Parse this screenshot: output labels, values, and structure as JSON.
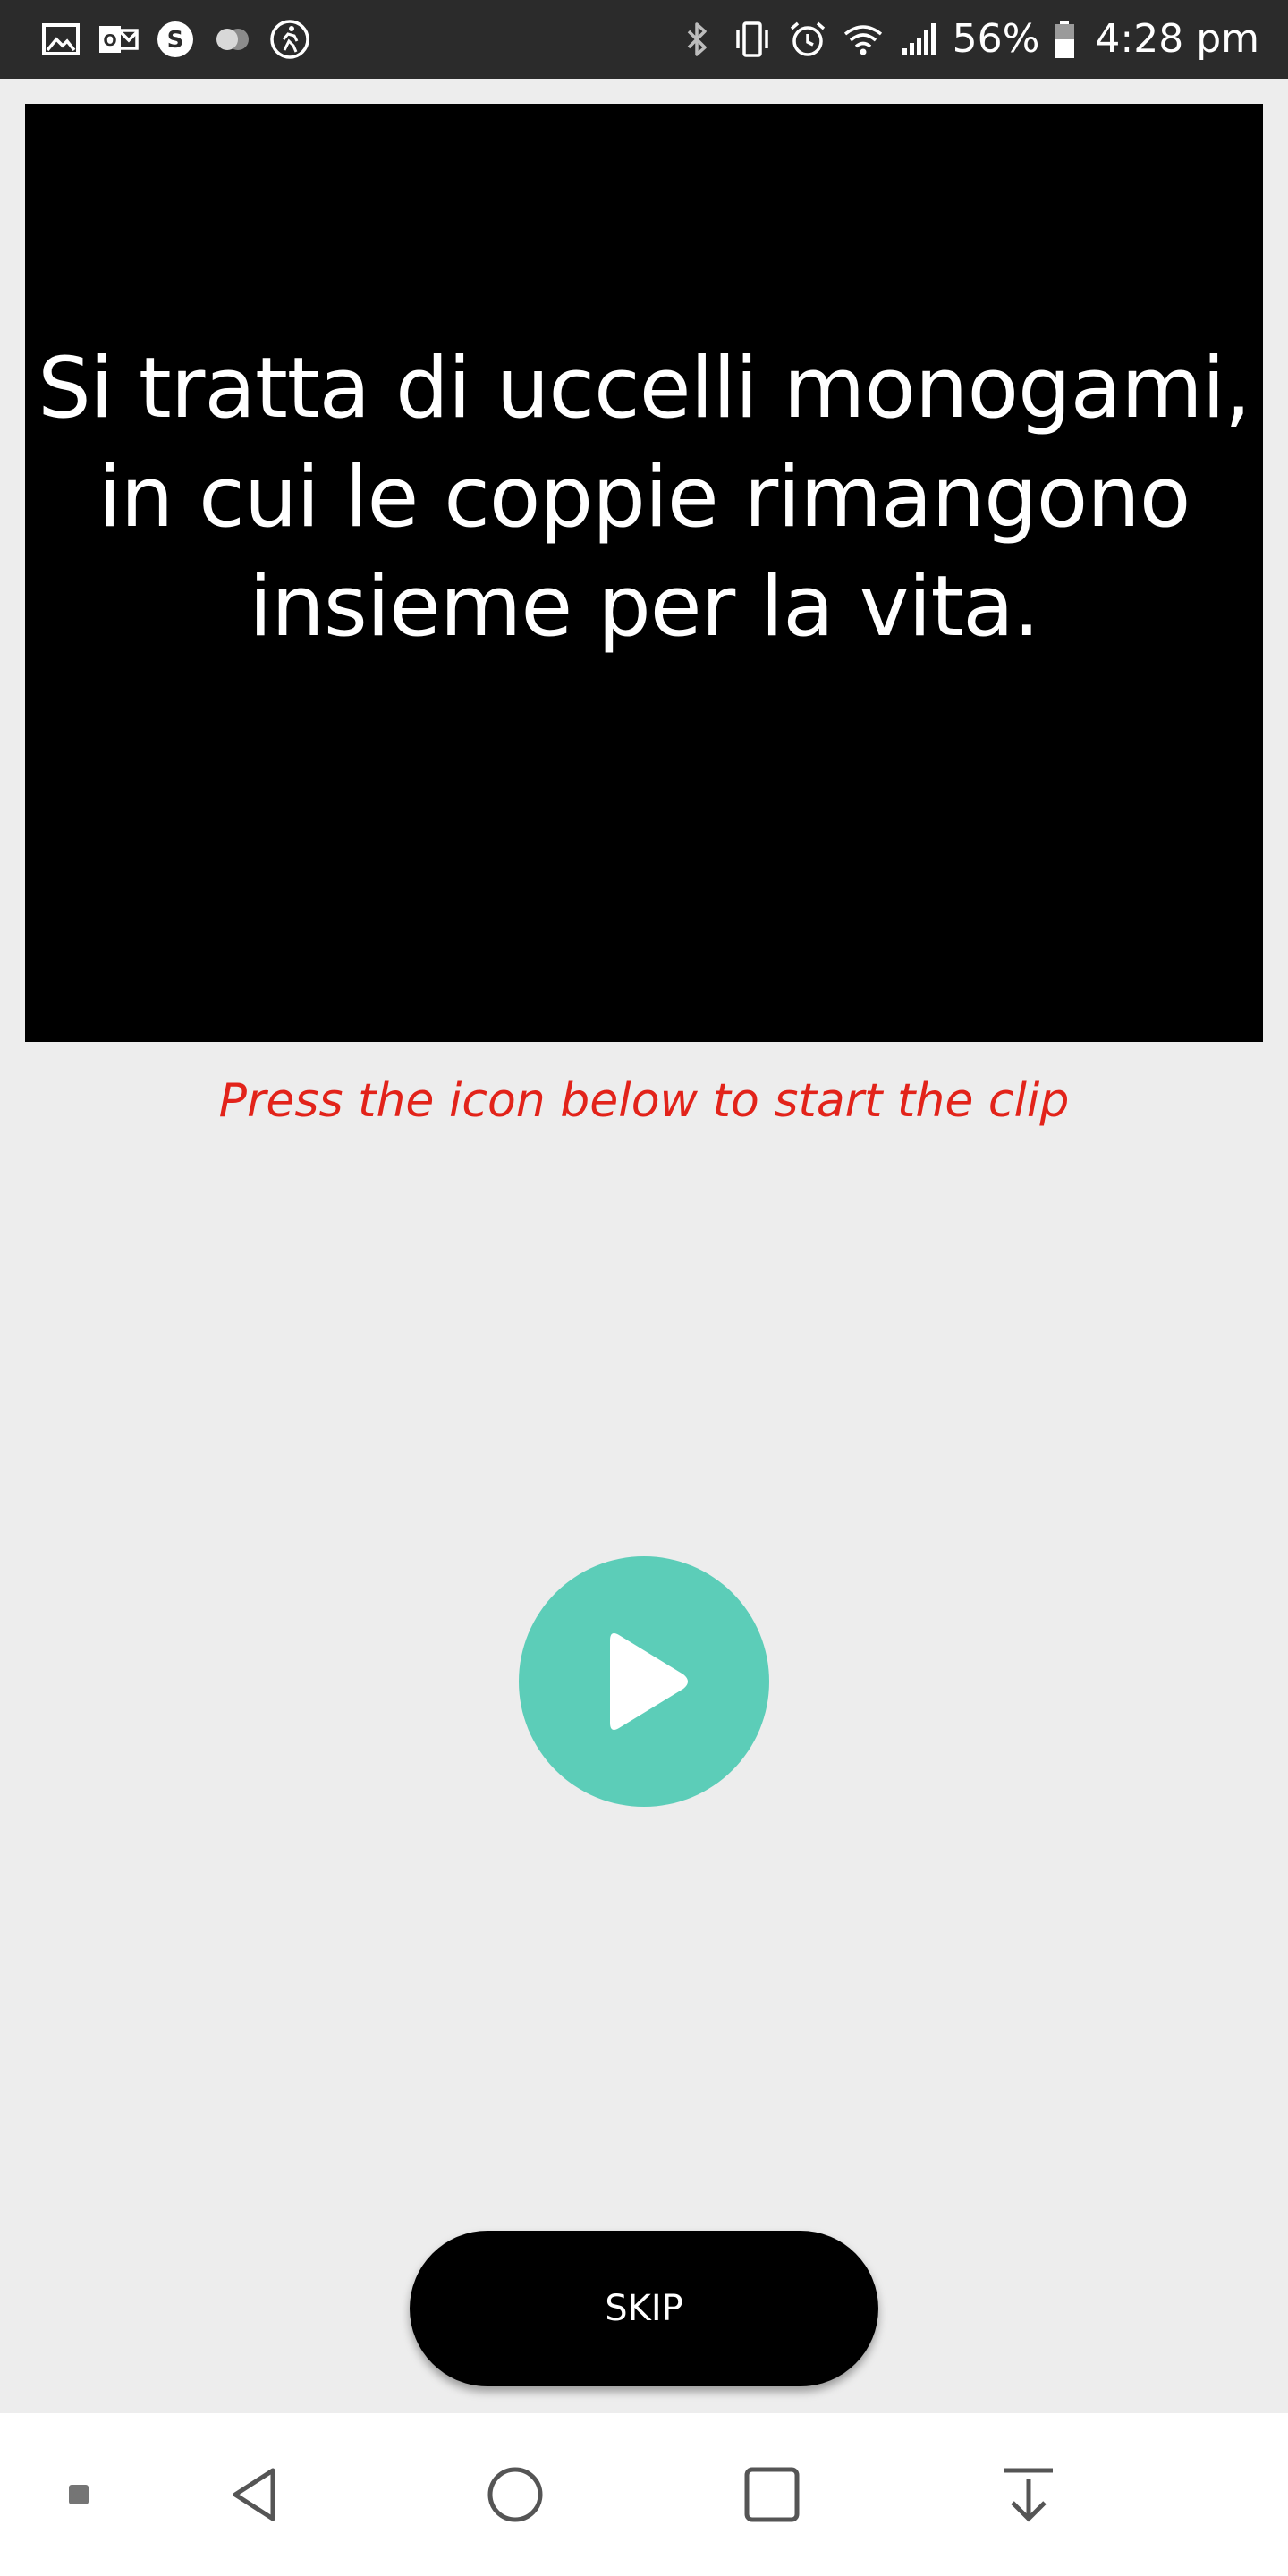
{
  "status_bar": {
    "left_icons": [
      "gallery-icon",
      "outlook-icon",
      "skype-icon",
      "toggle-icon",
      "fitness-icon"
    ],
    "right_icons": [
      "bluetooth-icon",
      "vibrate-icon",
      "alarm-icon",
      "wifi-icon",
      "signal-icon",
      "battery-icon"
    ],
    "battery": "56%",
    "time": "4:28 pm"
  },
  "video": {
    "caption_lines": [
      "Si tratta di uccelli monogami,",
      "in cui le coppie rimangono",
      "insieme per la vita."
    ]
  },
  "instruction": "Press the icon below to start the clip",
  "play_button": {
    "icon": "play-icon",
    "color": "#5ccdb8"
  },
  "skip_button": {
    "label": "SKIP"
  },
  "nav_bar": {
    "items": [
      "dot-icon",
      "back-icon",
      "home-icon",
      "recents-icon",
      "download-icon"
    ]
  },
  "colors": {
    "background": "#ededed",
    "status_bar": "#2b2b2b",
    "instruction": "#e2231a",
    "accent": "#5ccdb8"
  }
}
